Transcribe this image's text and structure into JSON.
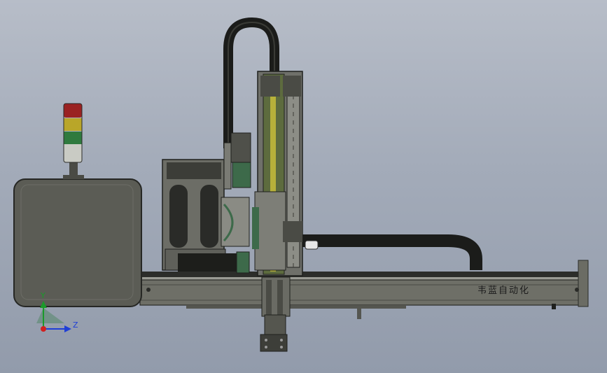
{
  "brand_text": "韦蓝自动化",
  "axes": {
    "y_label": "Y",
    "z_label": "Z"
  },
  "colors": {
    "y_axis": "#1a9a2a",
    "z_axis": "#1f3fd6",
    "origin": "#d02020",
    "cabinet": "#5b5c55",
    "frame": "#77786f",
    "drag_chain": "#1b1c1a",
    "beam": "#5d6b3e",
    "beam_stripe": "#b7b13a",
    "motor_green": "#3d6a4a",
    "light_red": "#9a2222",
    "light_yellow": "#b9a629",
    "light_green": "#2f7a3e"
  },
  "icons": [
    "signal-tower-icon",
    "triad-icon"
  ]
}
